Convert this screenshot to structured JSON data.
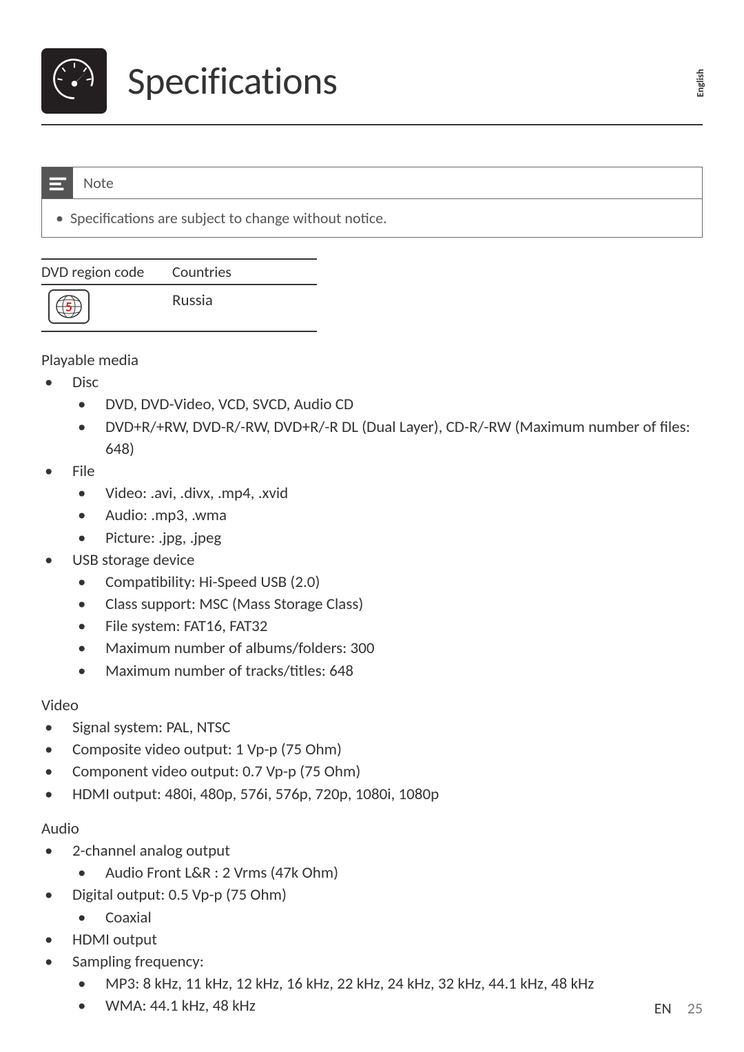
{
  "header": {
    "title": "Specifications",
    "side_tab": "English"
  },
  "note": {
    "label": "Note",
    "body": "Specifications are subject to change without notice."
  },
  "region_table": {
    "col1_header": "DVD region code",
    "col2_header": "Countries",
    "region_number": "5",
    "country": "Russia"
  },
  "playable_media": {
    "title": "Playable media",
    "disc": {
      "label": "Disc",
      "items": [
        "DVD, DVD-Video, VCD, SVCD, Audio CD",
        "DVD+R/+RW, DVD-R/-RW, DVD+R/-R DL (Dual Layer), CD-R/-RW (Maximum number of files: 648)"
      ]
    },
    "file": {
      "label": "File",
      "items": [
        "Video: .avi, .divx, .mp4, .xvid",
        "Audio: .mp3, .wma",
        "Picture: .jpg, .jpeg"
      ]
    },
    "usb": {
      "label": "USB storage device",
      "items": [
        "Compatibility: Hi-Speed USB (2.0)",
        "Class support: MSC (Mass Storage Class)",
        "File system: FAT16, FAT32",
        "Maximum number of albums/folders: 300",
        "Maximum number of tracks/titles: 648"
      ]
    }
  },
  "video": {
    "title": "Video",
    "items": [
      "Signal system: PAL, NTSC",
      "Composite video output: 1 Vp-p (75 Ohm)",
      "Component video output: 0.7 Vp-p (75 Ohm)",
      "HDMI output: 480i, 480p, 576i, 576p, 720p, 1080i, 1080p"
    ]
  },
  "audio": {
    "title": "Audio",
    "analog": {
      "label": "2-channel analog output",
      "items": [
        "Audio Front L&R : 2 Vrms (47k Ohm)"
      ]
    },
    "digital": {
      "label": "Digital output: 0.5 Vp-p (75 Ohm)",
      "items": [
        "Coaxial"
      ]
    },
    "hdmi": {
      "label": "HDMI output"
    },
    "sampling": {
      "label": "Sampling frequency:",
      "items": [
        "MP3: 8 kHz, 11 kHz, 12 kHz, 16 kHz, 22 kHz, 24 kHz, 32 kHz, 44.1 kHz, 48 kHz",
        "WMA: 44.1 kHz, 48 kHz"
      ]
    }
  },
  "footer": {
    "lang": "EN",
    "page": "25"
  },
  "chart_data": {
    "type": "table",
    "title": "DVD region code table",
    "columns": [
      "DVD region code",
      "Countries"
    ],
    "rows": [
      [
        "5",
        "Russia"
      ]
    ]
  }
}
